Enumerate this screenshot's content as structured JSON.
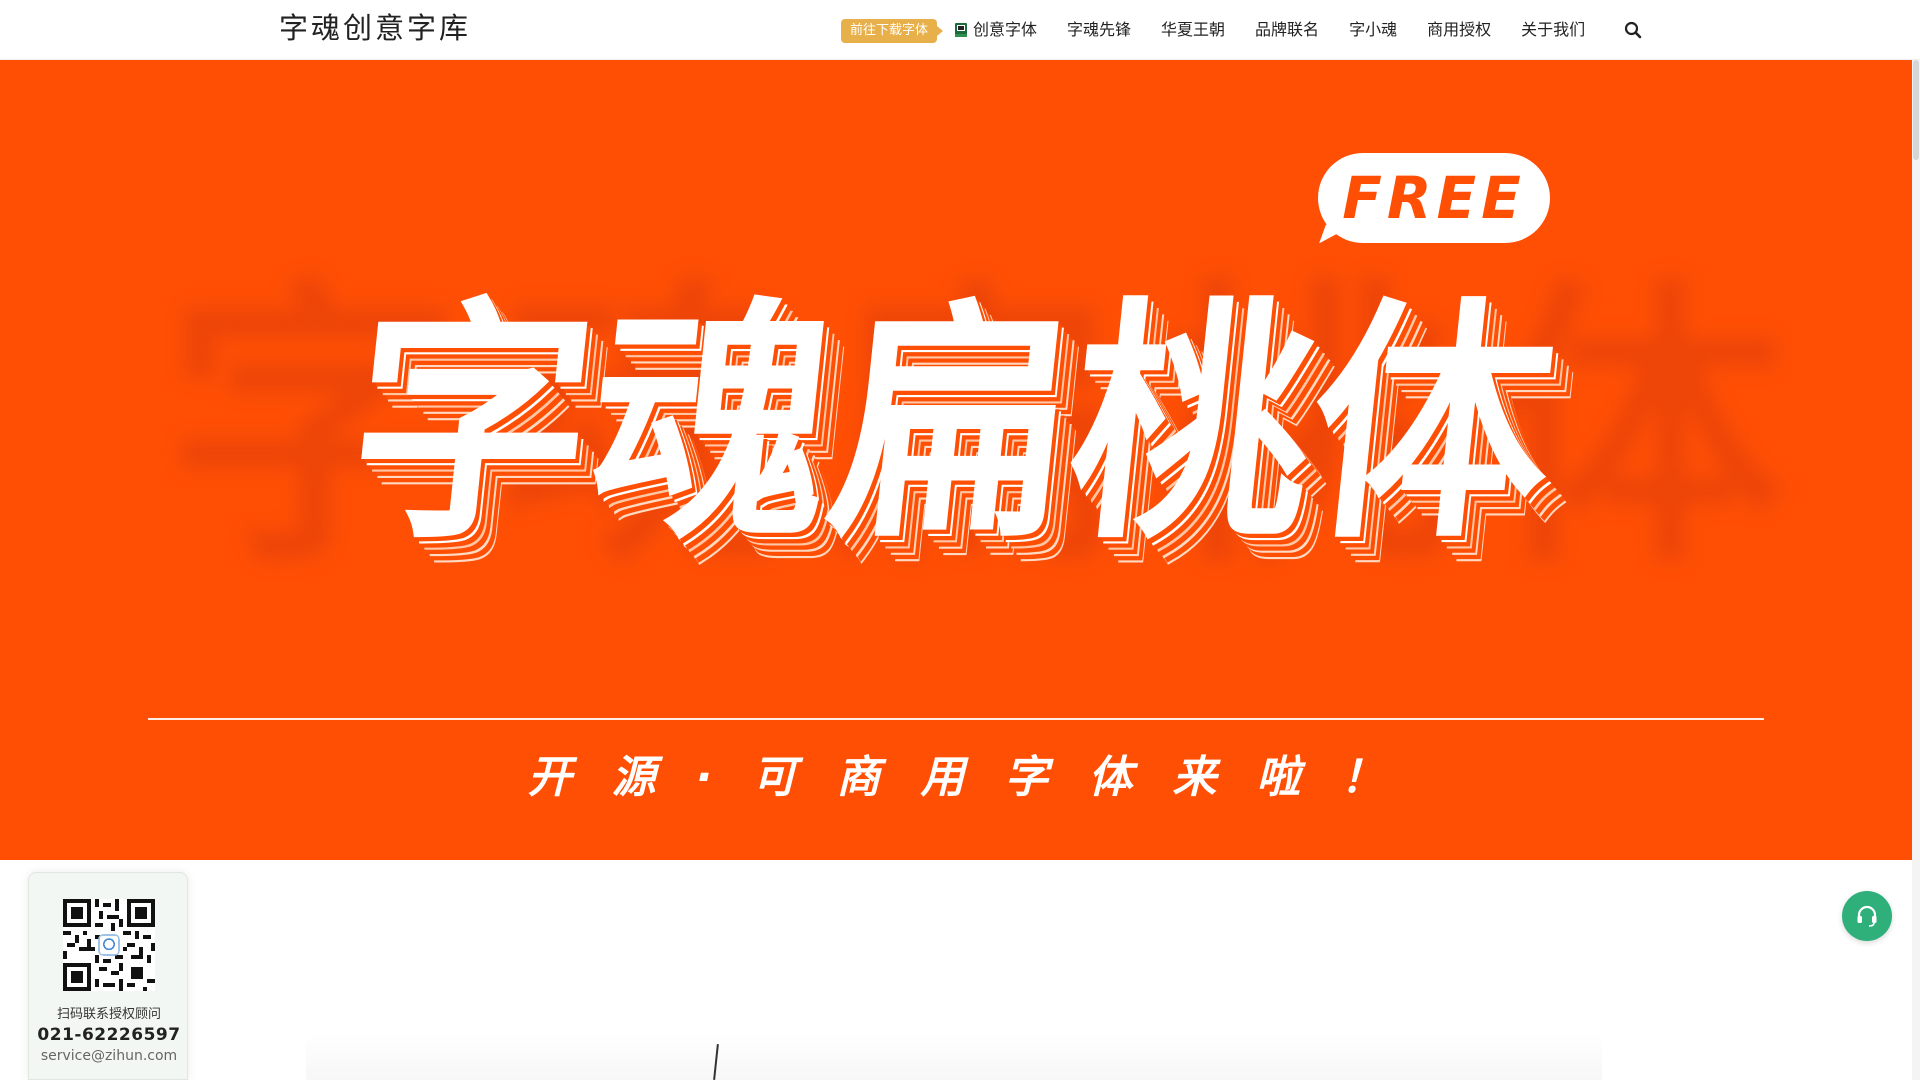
{
  "header": {
    "logo": "字魂创意字库",
    "download_badge": "前往下载字体",
    "nav": [
      {
        "label": "创意字体"
      },
      {
        "label": "字魂先锋"
      },
      {
        "label": "华夏王朝"
      },
      {
        "label": "品牌联名"
      },
      {
        "label": "字小魂"
      },
      {
        "label": "商用授权"
      },
      {
        "label": "关于我们"
      }
    ],
    "search_icon": "search-icon",
    "book_icon": "book-icon"
  },
  "hero": {
    "background_text": "字魂扁桃体",
    "title": "字魂扁桃体",
    "badge": "FREE",
    "subtitle": "开源·可商用字体来啦！",
    "colors": {
      "background": "#ff4f05",
      "text": "#ffffff"
    }
  },
  "contact": {
    "qr_label": "扫码联系授权顾问",
    "phone": "021-62226597",
    "email": "service@zihun.com"
  },
  "support": {
    "icon": "headset-icon",
    "color": "#2fb07b"
  }
}
